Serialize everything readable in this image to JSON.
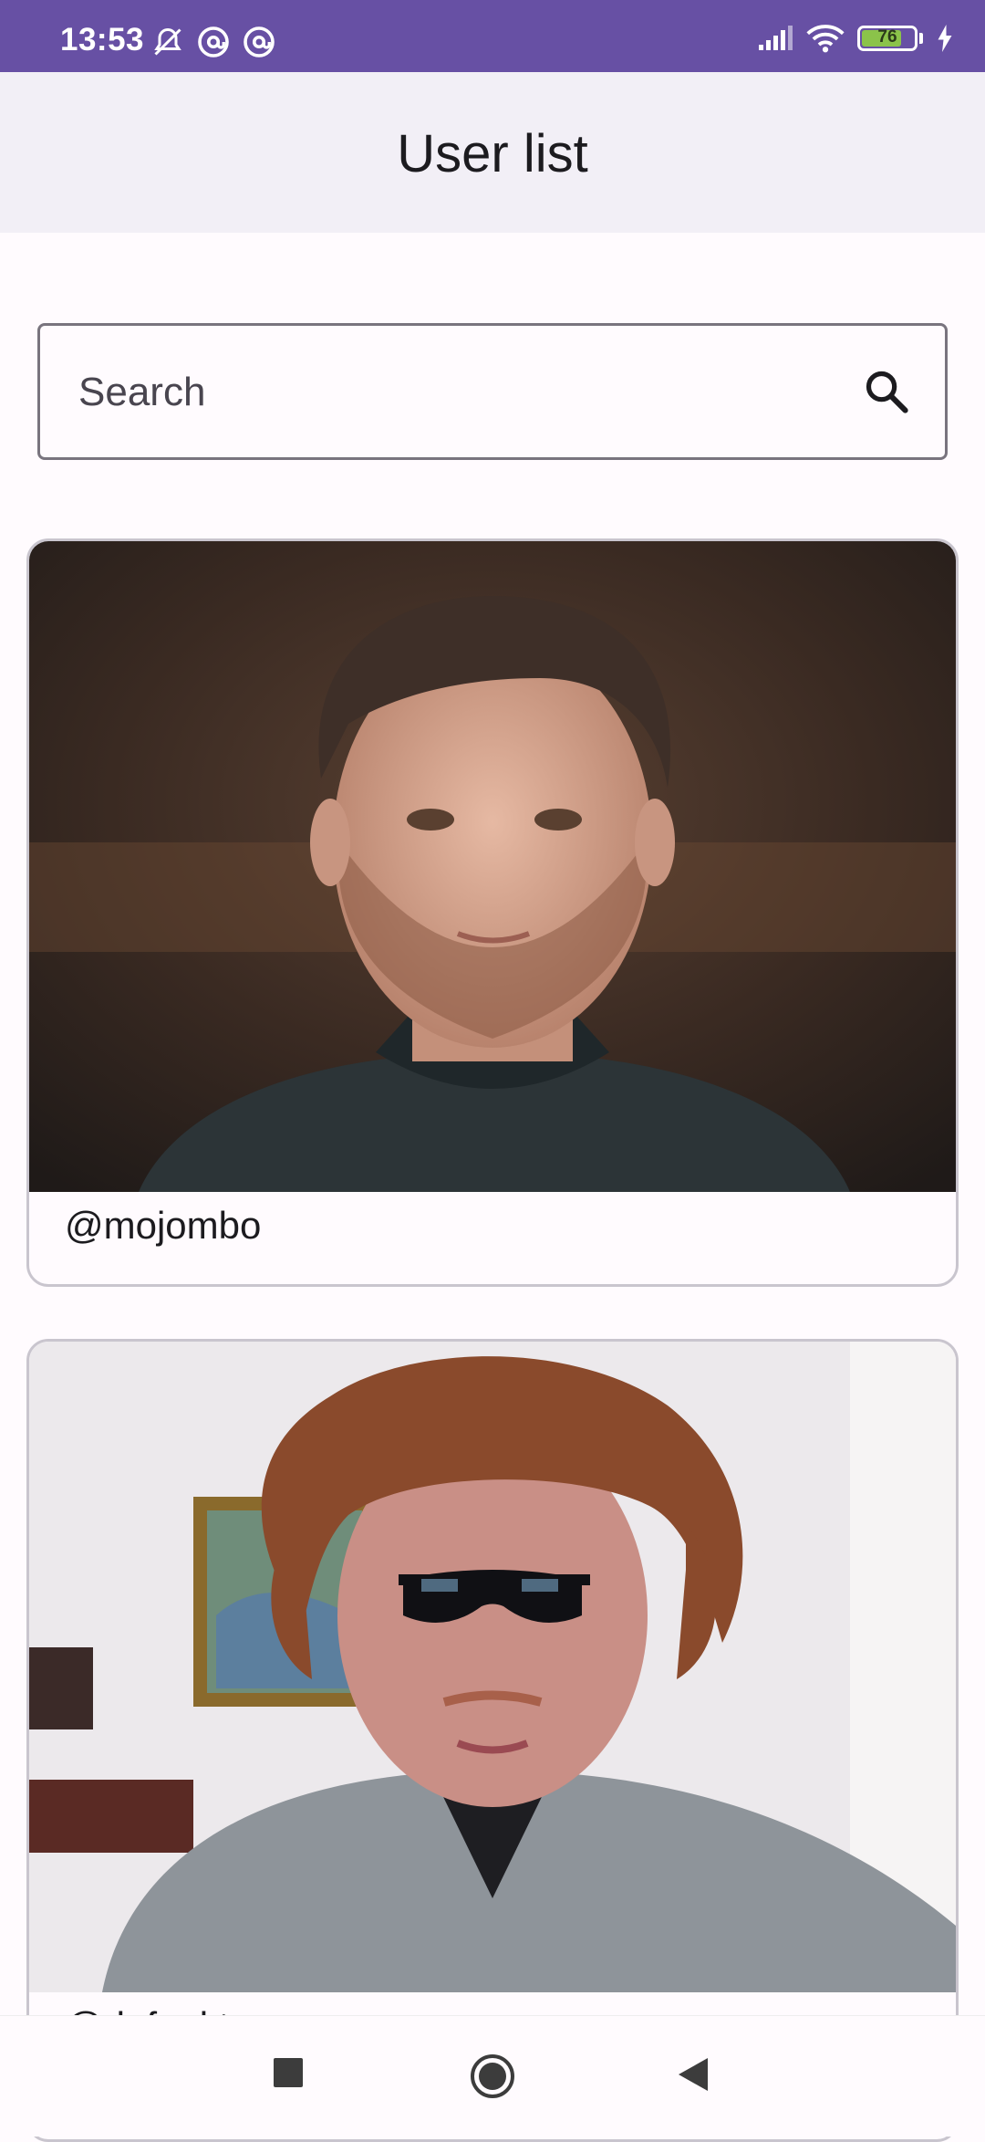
{
  "status_bar": {
    "time": "13:53",
    "battery_level": "76",
    "battery_fraction": 0.76,
    "icons_left": [
      "mute-bell-icon",
      "at-sign-icon",
      "at-sign-icon"
    ],
    "icons_right": [
      "signal-icon",
      "wifi-icon",
      "battery-icon",
      "charging-icon"
    ],
    "color": "#6750a4"
  },
  "app_bar": {
    "title": "User list"
  },
  "search": {
    "placeholder": "Search",
    "value": ""
  },
  "users": [
    {
      "username": "@mojombo",
      "avatar": "photo-of-man-with-short-brown-hair"
    },
    {
      "username": "@defunkt",
      "avatar": "photo-of-man-with-red-hair-and-sunglasses"
    }
  ],
  "nav_bar": {
    "buttons": [
      "recents-icon",
      "home-icon",
      "back-icon"
    ]
  }
}
